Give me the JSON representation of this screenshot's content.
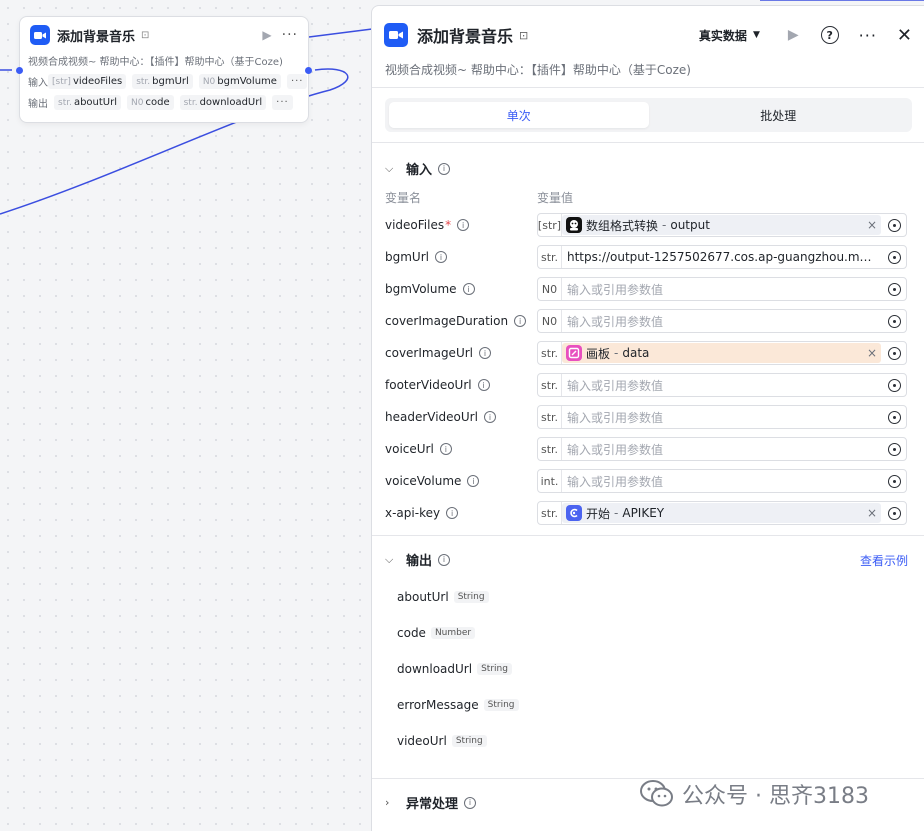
{
  "node": {
    "title": "添加背景音乐",
    "description": "视频合成视频~ 帮助中心：【插件】帮助中心（基于Coze)",
    "input_label": "输入",
    "output_label": "输出",
    "inputs": [
      {
        "type": "[str]",
        "name": "videoFiles"
      },
      {
        "type": "str.",
        "name": "bgmUrl"
      },
      {
        "type": "N0",
        "name": "bgmVolume"
      }
    ],
    "outputs": [
      {
        "type": "str.",
        "name": "aboutUrl"
      },
      {
        "type": "N0",
        "name": "code"
      },
      {
        "type": "str.",
        "name": "downloadUrl"
      }
    ],
    "more": "···"
  },
  "panel": {
    "title": "添加背景音乐",
    "description": "视频合成视频~ 帮助中心：【插件】帮助中心（基于Coze)",
    "data_mode": "真实数据",
    "tabs": [
      {
        "label": "单次",
        "active": true
      },
      {
        "label": "批处理",
        "active": false
      }
    ],
    "input_section": {
      "title": "输入",
      "col_name": "变量名",
      "col_value": "变量值",
      "params": [
        {
          "name": "videoFiles",
          "required": true,
          "type": "[str]",
          "kind": "ref",
          "ref_source": "数组格式转换",
          "ref_field": "output",
          "icon": "robot-icon",
          "style": "grey"
        },
        {
          "name": "bgmUrl",
          "required": false,
          "type": "str.",
          "kind": "value",
          "value": "https://output-1257502677.cos.ap-guangzhou.myqcl..."
        },
        {
          "name": "bgmVolume",
          "required": false,
          "type": "N0",
          "kind": "empty",
          "placeholder": "输入或引用参数值"
        },
        {
          "name": "coverImageDuration",
          "required": false,
          "type": "N0",
          "kind": "empty",
          "placeholder": "输入或引用参数值"
        },
        {
          "name": "coverImageUrl",
          "required": false,
          "type": "str.",
          "kind": "ref",
          "ref_source": "画板",
          "ref_field": "data",
          "icon": "canvas-icon",
          "style": "peach"
        },
        {
          "name": "footerVideoUrl",
          "required": false,
          "type": "str.",
          "kind": "empty",
          "placeholder": "输入或引用参数值"
        },
        {
          "name": "headerVideoUrl",
          "required": false,
          "type": "str.",
          "kind": "empty",
          "placeholder": "输入或引用参数值"
        },
        {
          "name": "voiceUrl",
          "required": false,
          "type": "str.",
          "kind": "empty",
          "placeholder": "输入或引用参数值"
        },
        {
          "name": "voiceVolume",
          "required": false,
          "type": "int.",
          "kind": "empty",
          "placeholder": "输入或引用参数值"
        },
        {
          "name": "x-api-key",
          "required": false,
          "type": "str.",
          "kind": "ref",
          "ref_source": "开始",
          "ref_field": "APIKEY",
          "icon": "start-icon",
          "style": "grey"
        }
      ]
    },
    "output_section": {
      "title": "输出",
      "view_example": "查看示例",
      "outputs": [
        {
          "name": "aboutUrl",
          "type": "String"
        },
        {
          "name": "code",
          "type": "Number"
        },
        {
          "name": "downloadUrl",
          "type": "String"
        },
        {
          "name": "errorMessage",
          "type": "String"
        },
        {
          "name": "videoUrl",
          "type": "String"
        }
      ]
    },
    "exception_section": {
      "title": "异常处理"
    }
  },
  "watermark": {
    "text": "公众号 · 思齐3183"
  },
  "colors": {
    "accent": "#3b5cf5",
    "node_icon": "#1f5cf5",
    "link": "#3b5cf5",
    "required": "#e5484d"
  }
}
